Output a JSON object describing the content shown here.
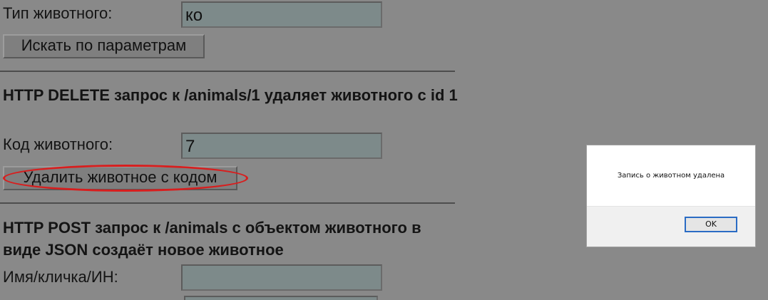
{
  "search_section": {
    "animal_type_label": "Тип животного:",
    "animal_type_value": "ко",
    "search_button": "Искать по параметрам"
  },
  "delete_section": {
    "heading": "HTTP DELETE запрос к /animals/1 удаляет животного с id 1",
    "code_label": "Код животного:",
    "code_value": "7",
    "delete_button": "Удалить животное с кодом",
    "highlight_color": "#d81e1e"
  },
  "post_section": {
    "heading": "HTTP POST запрос к /animals с объектом животного в виде JSON создаёт новое животное",
    "name_label": "Имя/кличка/ИН:",
    "name_value": ""
  },
  "alert_dialog": {
    "message": "Запись о животном удалена",
    "ok_button": "OK",
    "focus_color": "#2b6cc4"
  }
}
